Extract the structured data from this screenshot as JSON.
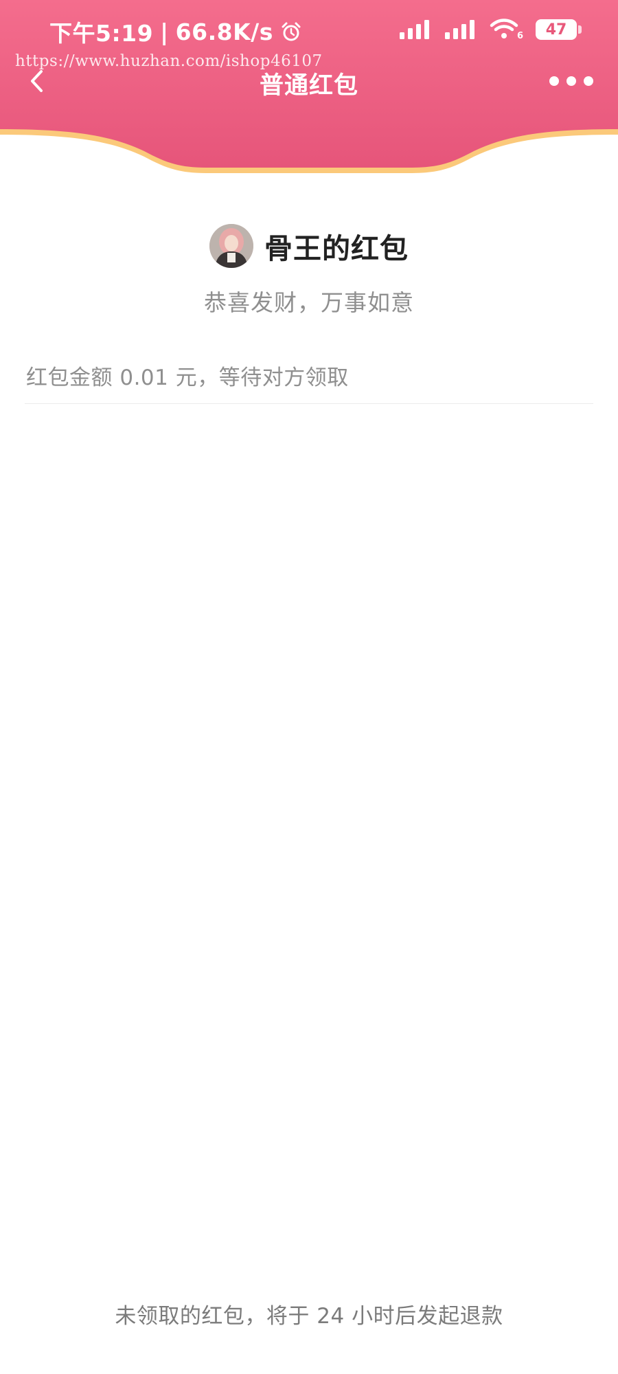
{
  "status_bar": {
    "time": "下午5:19",
    "separator": "|",
    "net_speed": "66.8K/s",
    "alarm_icon": "alarm-clock-icon",
    "signal_icon": "cellular-signal-icon",
    "wifi_icon": "wifi-icon",
    "wifi_label": "6",
    "battery_level": "47"
  },
  "watermark": {
    "text": "https://www.huzhan.com/ishop46107"
  },
  "nav": {
    "back_icon": "chevron-left-icon",
    "title": "普通红包",
    "more_icon": "more-horizontal-icon"
  },
  "envelope": {
    "sender_name": "骨王的红包",
    "greeting": "恭喜发财，万事如意",
    "amount_status": "红包金额 0.01 元，等待对方领取",
    "refund_note": "未领取的红包，将于 24 小时后发起退款"
  },
  "colors": {
    "header_top": "#f26a8a",
    "header_bottom": "#e8587a",
    "gold_border": "#fbc97a",
    "muted_text": "#8f8f8f",
    "primary_text": "#222222"
  }
}
